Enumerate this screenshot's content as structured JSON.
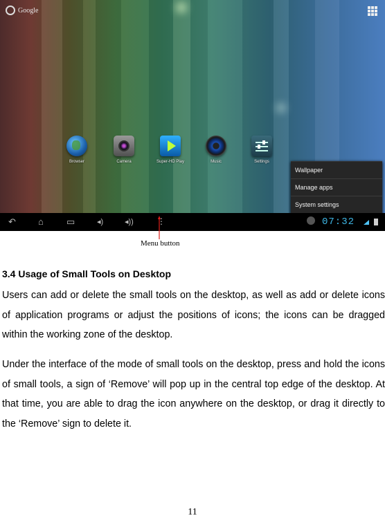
{
  "screen": {
    "search_label": "Google",
    "apps": [
      {
        "label": "Browser",
        "icon": "globe-icon"
      },
      {
        "label": "Camera",
        "icon": "camera-icon"
      },
      {
        "label": "Super-HD Play",
        "icon": "play-icon"
      },
      {
        "label": "Music",
        "icon": "speaker-icon"
      },
      {
        "label": "Settings",
        "icon": "settings-sliders-icon"
      }
    ],
    "menu": {
      "items": [
        "Wallpaper",
        "Manage apps",
        "System settings"
      ]
    },
    "navbar": {
      "clock": "07:32",
      "accent_color": "#3fb7e6"
    }
  },
  "caption": "Menu button",
  "section": {
    "heading": "3.4 Usage of Small Tools on Desktop",
    "paragraph1": "Users can add or delete the small tools on the desktop, as well as add or delete icons of application programs or adjust the positions of icons; the icons can be dragged within the working zone of the desktop.",
    "paragraph2": "Under the interface of the mode of small tools on the desktop, press and hold the icons of small tools, a sign of ‘Remove’ will pop up in the central top edge of the desktop. At that time, you are able to drag the icon anywhere on the desktop, or drag it directly to the ‘Remove’ sign to delete it."
  },
  "page_number": "11",
  "arrow_color": "#e0201a"
}
